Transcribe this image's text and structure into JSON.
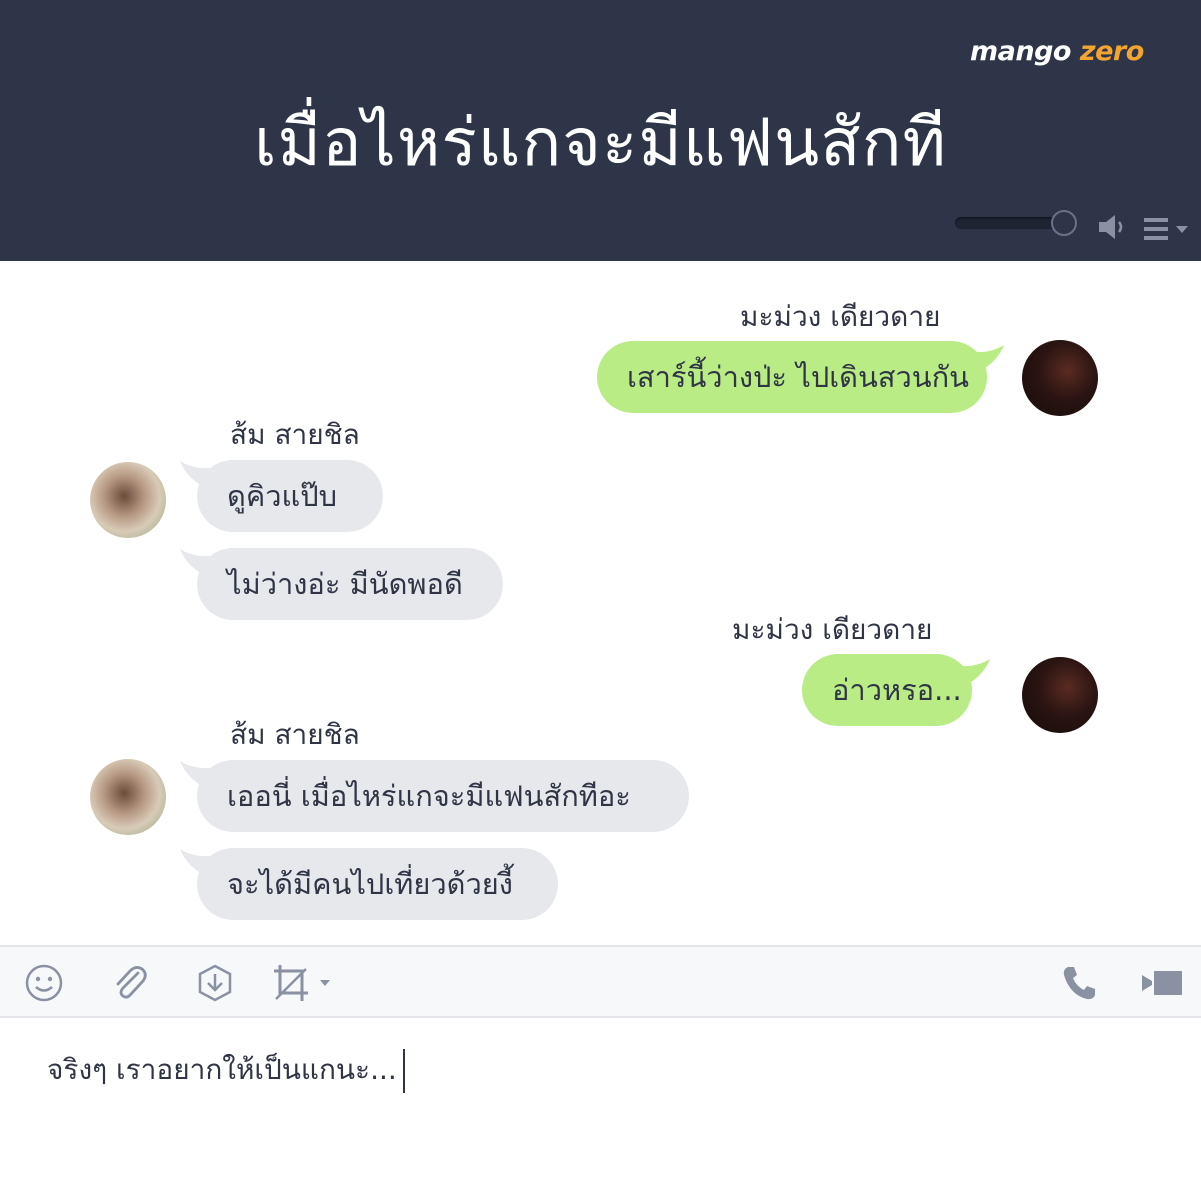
{
  "header": {
    "logo": {
      "part1": "mango",
      "part2": "zero"
    },
    "title": "เมื่อไหร่แกจะมีแฟนสักที"
  },
  "messages": [
    {
      "side": "right",
      "sender": "มะม่วง เดียวดาย",
      "texts": [
        "เสาร์นี้ว่างป่ะ ไปเดินสวนกัน"
      ]
    },
    {
      "side": "left",
      "sender": "ส้ม สายชิล",
      "texts": [
        "ดูคิวแป๊บ",
        "ไม่ว่างอ่ะ มีนัดพอดี"
      ]
    },
    {
      "side": "right",
      "sender": "มะม่วง เดียวดาย",
      "texts": [
        "อ่าวหรอ..."
      ]
    },
    {
      "side": "left",
      "sender": "ส้ม สายชิล",
      "texts": [
        "เออนี่ เมื่อไหร่แกจะมีแฟนสักทีอะ",
        "จะได้มีคนไปเที่ยวด้วยงี้"
      ]
    }
  ],
  "composer": {
    "value": "จริงๆ เราอยากให้เป็นแกนะ..."
  },
  "colors": {
    "header_bg": "#2e3548",
    "outgoing_bubble": "#b9ec85",
    "incoming_bubble": "#e6e8ec",
    "text": "#2f3545",
    "logo_accent": "#f3a531"
  },
  "icons": {
    "toolbar_left": [
      "smiley-icon",
      "paperclip-icon",
      "download-icon",
      "crop-icon"
    ],
    "toolbar_right": [
      "phone-icon",
      "video-icon"
    ],
    "header": [
      "volume-slider",
      "speaker-icon",
      "menu-icon"
    ]
  }
}
